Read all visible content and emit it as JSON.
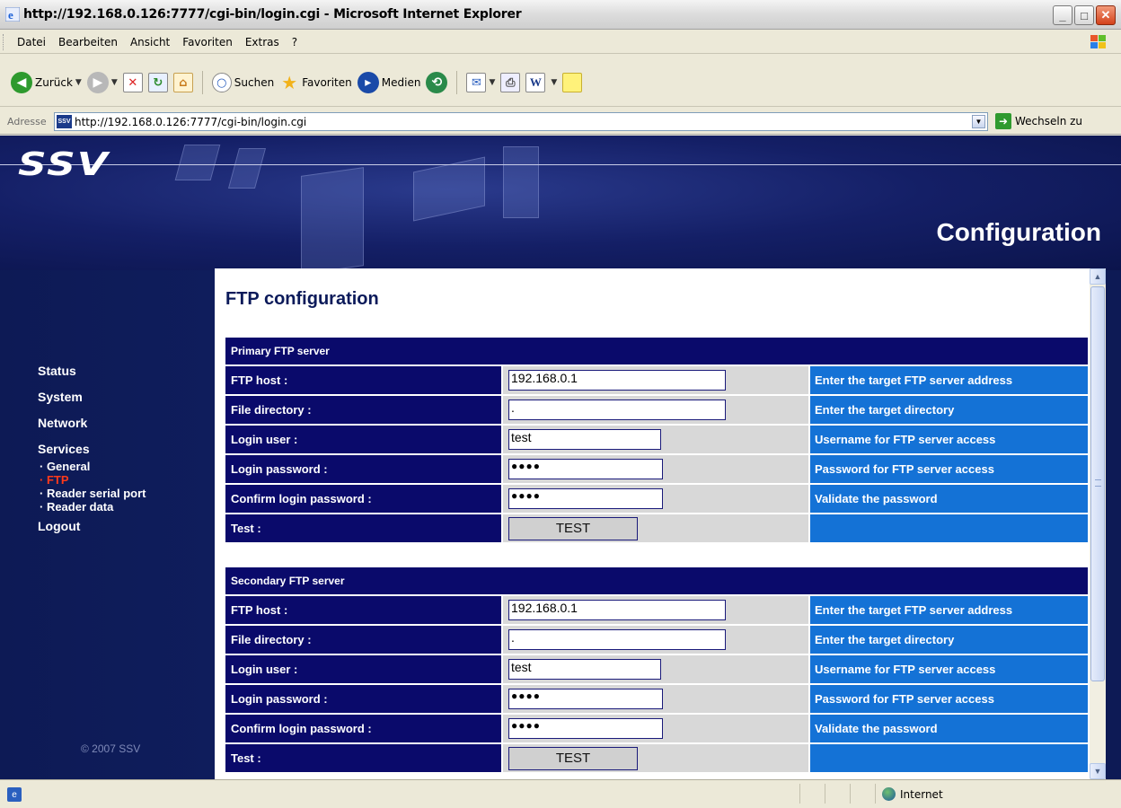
{
  "window": {
    "title": "http://192.168.0.126:7777/cgi-bin/login.cgi - Microsoft Internet Explorer"
  },
  "menu": [
    "Datei",
    "Bearbeiten",
    "Ansicht",
    "Favoriten",
    "Extras",
    "?"
  ],
  "toolbar": {
    "back": "Zurück",
    "search": "Suchen",
    "favorites": "Favoriten",
    "media": "Medien"
  },
  "address": {
    "label": "Adresse",
    "url": "http://192.168.0.126:7777/cgi-bin/login.cgi",
    "go": "Wechseln zu"
  },
  "banner": {
    "logo": "SSV",
    "heading": "Configuration"
  },
  "nav": {
    "items": [
      "Status",
      "System",
      "Network",
      "Services"
    ],
    "sub": [
      "· General",
      "· FTP",
      "· Reader serial port",
      "· Reader data"
    ],
    "logout": "Logout",
    "active": "· FTP"
  },
  "copyright": "© 2007 SSV",
  "page": {
    "title": "FTP configuration",
    "primary": {
      "header": "Primary FTP server",
      "ftp_host_label": "FTP host :",
      "ftp_host_value": "192.168.0.1",
      "ftp_host_help": "Enter the target FTP server address",
      "dir_label": "File directory :",
      "dir_value": ".",
      "dir_help": "Enter the target directory",
      "user_label": "Login user :",
      "user_value": "test",
      "user_help": "Username for FTP server access",
      "pw_label": "Login password :",
      "pw_value": "●●●●",
      "pw_help": "Password for FTP server access",
      "cpw_label": "Confirm login password :",
      "cpw_value": "●●●●",
      "cpw_help": "Validate the password",
      "test_label": "Test :",
      "test_button": "TEST"
    },
    "secondary": {
      "header": "Secondary FTP server",
      "ftp_host_label": "FTP host :",
      "ftp_host_value": "192.168.0.1",
      "ftp_host_help": "Enter the target FTP server address",
      "dir_label": "File directory :",
      "dir_value": ".",
      "dir_help": "Enter the target directory",
      "user_label": "Login user :",
      "user_value": "test",
      "user_help": "Username for FTP server access",
      "pw_label": "Login password :",
      "pw_value": "●●●●",
      "pw_help": "Password for FTP server access",
      "cpw_label": "Confirm login password :",
      "cpw_value": "●●●●",
      "cpw_help": "Validate the password",
      "test_label": "Test :",
      "test_button": "TEST"
    }
  },
  "status": {
    "zone": "Internet"
  },
  "colors": {
    "navy": "#0a0a6b",
    "help_blue": "#1472d6",
    "active_nav": "#ff3a1a"
  }
}
